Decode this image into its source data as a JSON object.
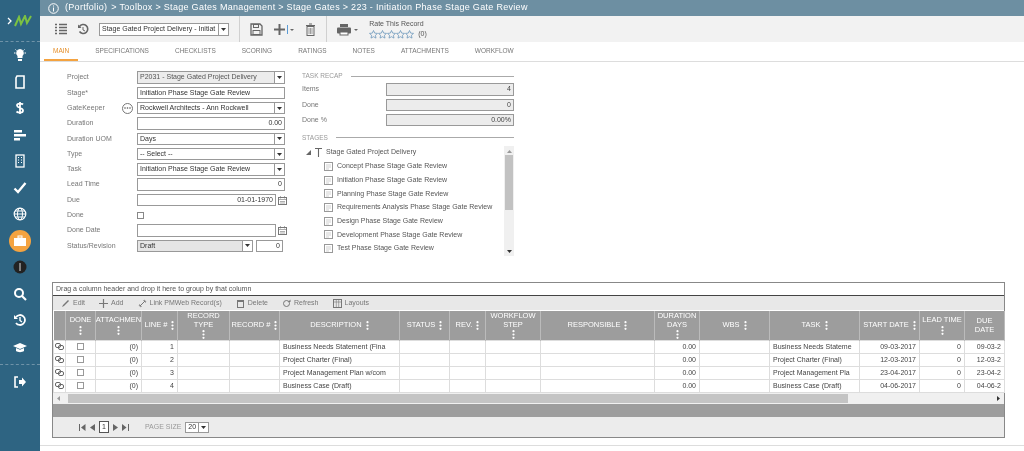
{
  "breadcrumb": {
    "link": "(Portfolio)",
    "path": "> Toolbox > Stage Gates Management > Stage Gates > 223 - Initiation Phase Stage Gate Review"
  },
  "sidebar": {
    "items": [
      {
        "selected": false
      },
      {
        "selected": false
      },
      {
        "selected": false
      },
      {
        "selected": false
      },
      {
        "selected": false
      },
      {
        "selected": false
      },
      {
        "selected": false
      },
      {
        "selected": true
      },
      {
        "selected": false
      },
      {
        "selected": false
      },
      {
        "selected": false
      },
      {
        "selected": false
      },
      {
        "selected": false
      }
    ]
  },
  "toolbar": {
    "record_select": "Stage Gated Project Delivery - Initiat",
    "rating": {
      "label": "Rate This Record",
      "stars": 0,
      "count": "(0)"
    }
  },
  "tabs": [
    {
      "label": "MAIN",
      "selected": true
    },
    {
      "label": "SPECIFICATIONS",
      "selected": false
    },
    {
      "label": "CHECKLISTS",
      "selected": false
    },
    {
      "label": "SCORING",
      "selected": false
    },
    {
      "label": "RATINGS",
      "selected": false
    },
    {
      "label": "NOTES",
      "selected": false
    },
    {
      "label": "ATTACHMENTS",
      "selected": false
    },
    {
      "label": "WORKFLOW",
      "selected": false
    }
  ],
  "form": [
    {
      "label": "Project",
      "kind": "select",
      "value": "P2031 - Stage Gated Project Delivery"
    },
    {
      "label": "Stage*",
      "kind": "text",
      "value": "Initiation Phase Stage Gate Review"
    },
    {
      "label": "GateKeeper",
      "kind": "lookup",
      "value": "Rockwell Architects - Ann Rockwell"
    },
    {
      "label": "Duration",
      "kind": "number",
      "value": "0.00"
    },
    {
      "label": "Duration UOM",
      "kind": "select",
      "value": "Days"
    },
    {
      "label": "Type",
      "kind": "select",
      "value": "-- Select --"
    },
    {
      "label": "Task",
      "kind": "select",
      "value": "Initiation Phase Stage Gate Review"
    },
    {
      "label": "Lead Time",
      "kind": "number",
      "value": "0"
    },
    {
      "label": "Due",
      "kind": "date",
      "value": "01-01-1970"
    },
    {
      "label": "Done",
      "kind": "checkbox",
      "checked": false
    },
    {
      "label": "Done Date",
      "kind": "date"
    },
    {
      "label": "Status/Revision",
      "kind": "status",
      "value": "Draft",
      "revision": "0"
    }
  ],
  "task_recap": {
    "title": "TASK RECAP",
    "fields": [
      {
        "label": "Items",
        "value": "4"
      },
      {
        "label": "Done",
        "value": "0"
      },
      {
        "label": "Done %",
        "value": "0.00%"
      }
    ]
  },
  "stages": {
    "title": "STAGES",
    "tree": [
      {
        "label": "Stage Gated Project Delivery",
        "expanded": true,
        "children": [
          {
            "label": "Concept Phase Stage Gate Review"
          },
          {
            "label": "Initiation Phase Stage Gate Review"
          },
          {
            "label": "Planning Phase Stage Gate Review"
          },
          {
            "label": "Requirements Analysis Phase Stage Gate Review"
          },
          {
            "label": "Design Phase Stage Gate Review"
          },
          {
            "label": "Development Phase Stage Gate Review"
          },
          {
            "label": "Test Phase Stage Gate Review"
          }
        ]
      }
    ]
  },
  "grid": {
    "group_hint": "Drag a column header and drop it here to group by that column",
    "actions": [
      "Edit",
      "Add",
      "Link PMWeb Record(s)",
      "Delete",
      "Refresh",
      "Layouts"
    ],
    "columns": [
      {
        "label": "DONE",
        "menu": true
      },
      {
        "label": "ATTACHMEN",
        "menu": true
      },
      {
        "label": "LINE #",
        "menu": true
      },
      {
        "label": "RECORD TYPE",
        "menu": true
      },
      {
        "label": "RECORD #",
        "menu": true
      },
      {
        "label": "DESCRIPTION",
        "menu": true
      },
      {
        "label": "STATUS",
        "menu": true
      },
      {
        "label": "REV.",
        "menu": true
      },
      {
        "label": "WORKFLOW STEP",
        "menu": true
      },
      {
        "label": "RESPONSIBLE",
        "menu": true
      },
      {
        "label": "DURATION DAYS",
        "menu": true
      },
      {
        "label": "WBS",
        "menu": true
      },
      {
        "label": "TASK",
        "menu": true
      },
      {
        "label": "START DATE",
        "menu": true
      },
      {
        "label": "LEAD TIME",
        "menu": true
      },
      {
        "label": "DUE DATE",
        "menu": false
      }
    ],
    "rows": [
      {
        "done": false,
        "attachments": "(0)",
        "line": "1",
        "description": "Business Needs Statement (Fina",
        "duration": "0.00",
        "task": "Business Needs Stateme",
        "start_date": "09-03-2017",
        "lead_time": "0",
        "due_date": "09-03-2"
      },
      {
        "done": false,
        "attachments": "(0)",
        "line": "2",
        "description": "Project Charter (Final)",
        "duration": "0.00",
        "task": "Project Charter (Final)",
        "start_date": "12-03-2017",
        "lead_time": "0",
        "due_date": "12-03-2"
      },
      {
        "done": false,
        "attachments": "(0)",
        "line": "3",
        "description": "Project Management Plan w/com",
        "duration": "0.00",
        "task": "Project Management Pla",
        "start_date": "23-04-2017",
        "lead_time": "0",
        "due_date": "23-04-2"
      },
      {
        "done": false,
        "attachments": "(0)",
        "line": "4",
        "description": "Business Case (Draft)",
        "duration": "0.00",
        "task": "Business Case (Draft)",
        "start_date": "04-06-2017",
        "lead_time": "0",
        "due_date": "04-06-2"
      }
    ],
    "pager": {
      "page": "1",
      "page_size_label": "PAGE SIZE",
      "page_size": "20"
    }
  }
}
